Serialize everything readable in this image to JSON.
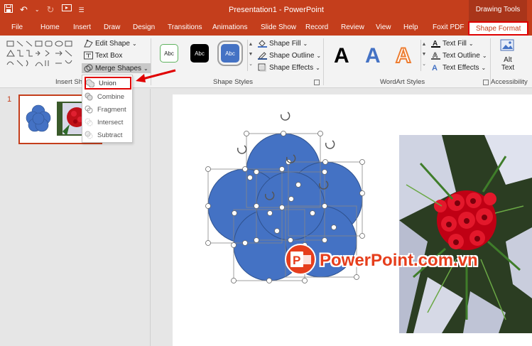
{
  "title_bar": {
    "document_title": "Presentation1 - PowerPoint",
    "contextual_tab_group": "Drawing Tools"
  },
  "tabs": [
    "File",
    "Home",
    "Insert",
    "Draw",
    "Design",
    "Transitions",
    "Animations",
    "Slide Show",
    "Record",
    "Review",
    "View",
    "Help",
    "Foxit PDF",
    "Shape Format"
  ],
  "active_tab": "Shape Format",
  "ribbon": {
    "insert_shapes": {
      "label": "Insert Sh",
      "edit_shape": "Edit Shape",
      "text_box": "Text Box",
      "merge_shapes": "Merge Shapes"
    },
    "shape_styles": {
      "label": "Shape Styles",
      "presets": [
        "Abc",
        "Abc",
        "Abc"
      ],
      "shape_fill": "Shape Fill",
      "shape_outline": "Shape Outline",
      "shape_effects": "Shape Effects"
    },
    "wordart_styles": {
      "label": "WordArt Styles",
      "presets": [
        "A",
        "A",
        "A"
      ],
      "text_fill": "Text Fill",
      "text_outline": "Text Outline",
      "text_effects": "Text Effects"
    },
    "accessibility": {
      "label": "Accessibility",
      "alt_text_line1": "Alt",
      "alt_text_line2": "Text"
    }
  },
  "merge_menu": {
    "items": [
      "Union",
      "Combine",
      "Fragment",
      "Intersect",
      "Subtract"
    ],
    "highlighted": "Union"
  },
  "slides": {
    "number": "1"
  },
  "watermark": {
    "text": "PowerPoint.com.vn",
    "logo_letter": "P"
  },
  "colors": {
    "accent": "#c43e1c",
    "shape_fill": "#4472c4",
    "highlight": "#e00000"
  }
}
